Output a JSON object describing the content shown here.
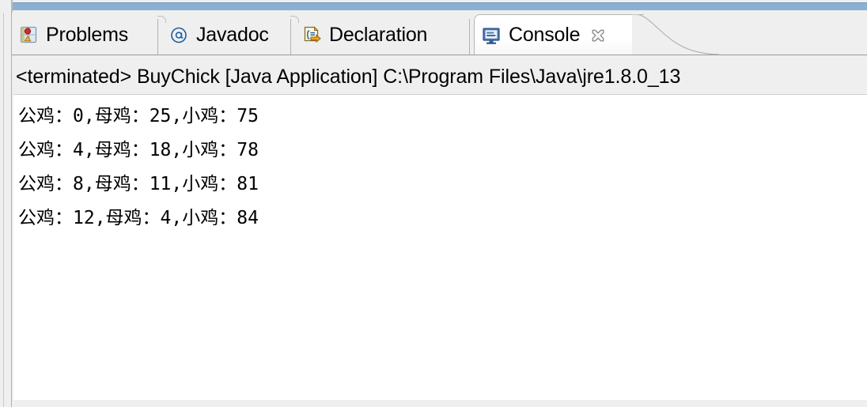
{
  "window": {
    "view_state": "active"
  },
  "tabs": [
    {
      "id": "problems",
      "label": "Problems",
      "icon": "problems-icon",
      "selected": false,
      "closable": false
    },
    {
      "id": "javadoc",
      "label": "Javadoc",
      "icon": "javadoc-at-icon",
      "selected": false,
      "closable": false
    },
    {
      "id": "declaration",
      "label": "Declaration",
      "icon": "declaration-icon",
      "selected": false,
      "closable": false
    },
    {
      "id": "console",
      "label": "Console",
      "icon": "console-monitor-icon",
      "selected": true,
      "closable": true,
      "close_icon": "close-icon"
    }
  ],
  "console": {
    "launch_header": "<terminated> BuyChick [Java Application] C:\\Program Files\\Java\\jre1.8.0_13",
    "output_lines": [
      "公鸡：0,母鸡：25,小鸡：75",
      "公鸡：4,母鸡：18,小鸡：78",
      "公鸡：8,母鸡：11,小鸡：81",
      "公鸡：12,母鸡：4,小鸡：84"
    ]
  },
  "colors": {
    "active_view_bar": "#8bb0d4",
    "panel_background": "#efefef",
    "console_background": "#ffffff",
    "text": "#000000",
    "tab_separator": "#b4b4b4"
  }
}
